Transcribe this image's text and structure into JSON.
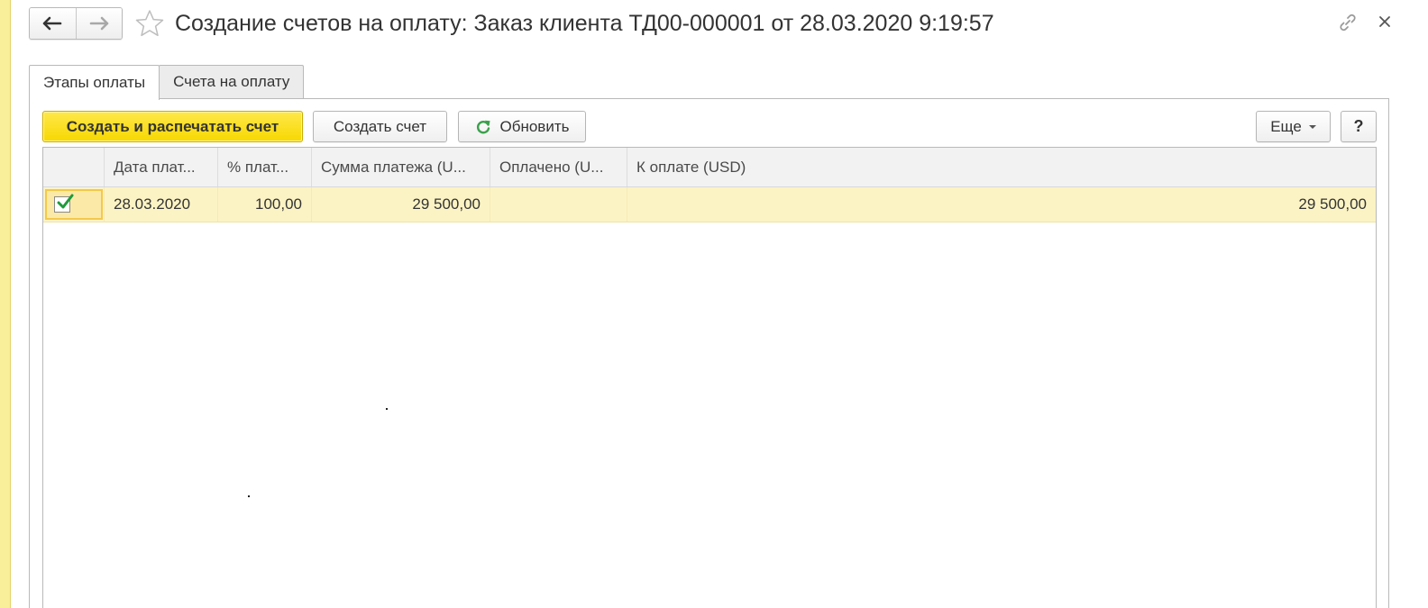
{
  "window": {
    "title": "Создание счетов на оплату: Заказ клиента ТД00-000001 от 28.03.2020 9:19:57"
  },
  "icons": {
    "back": "arrow-left-icon",
    "forward": "arrow-right-icon",
    "favorite": "star-icon",
    "link": "link-icon",
    "close": "close-icon",
    "refresh": "refresh-icon"
  },
  "colors": {
    "accent_yellow": "#f7d800",
    "row_highlight": "#fcf3c4",
    "refresh_green": "#3aa14c"
  },
  "tabs": [
    {
      "label": "Этапы оплаты",
      "active": true
    },
    {
      "label": "Счета на оплату",
      "active": false
    }
  ],
  "toolbar": {
    "create_print_label": "Создать и распечатать счет",
    "create_label": "Создать счет",
    "refresh_label": "Обновить",
    "more_label": "Еще",
    "help_label": "?"
  },
  "table": {
    "columns": [
      "",
      "Дата плат...",
      "% плат...",
      "Сумма платежа (U...",
      "Оплачено (U...",
      "К оплате (USD)"
    ],
    "rows": [
      {
        "checked": true,
        "date": "28.03.2020",
        "percent": "100,00",
        "amount": "29 500,00",
        "paid": "",
        "to_pay": "29 500,00"
      }
    ]
  }
}
